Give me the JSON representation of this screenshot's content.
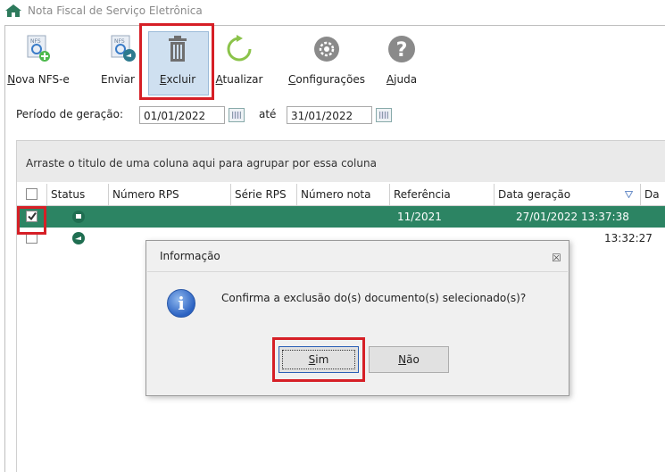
{
  "window": {
    "title": "Nota Fiscal de Serviço Eletrônica",
    "home_icon": "home-icon"
  },
  "toolbar": {
    "buttons": [
      {
        "label": "Nova NFS-e",
        "underline": "N",
        "rest": "ova NFS-e",
        "icon": "new-nfse-icon"
      },
      {
        "label": "Enviar",
        "underline": "",
        "rest": "Enviar",
        "icon": "send-nfse-icon"
      },
      {
        "label": "Excluir",
        "underline": "E",
        "rest": "xcluir",
        "icon": "trash-icon"
      },
      {
        "label": "Atualizar",
        "underline": "A",
        "rest": "tualizar",
        "icon": "refresh-icon"
      },
      {
        "label": "Configurações",
        "underline": "C",
        "rest": "onfigurações",
        "icon": "gear-icon"
      },
      {
        "label": "Ajuda",
        "underline": "A",
        "rest": "juda",
        "icon": "help-icon"
      }
    ]
  },
  "filters": {
    "period_label": "Período de geração:",
    "start_date": "01/01/2022",
    "until_label": "até",
    "end_date": "31/01/2022"
  },
  "grid": {
    "group_hint": "Arraste o titulo de uma coluna aqui para agrupar por essa coluna",
    "columns": [
      "Status",
      "Número RPS",
      "Série RPS",
      "Número nota",
      "Referência",
      "Data geração",
      "Da"
    ],
    "rows": [
      {
        "checked": true,
        "status_icon": "flag-icon",
        "referencia": "11/2021",
        "data_geracao": "27/01/2022 13:37:38",
        "selected": true
      },
      {
        "checked": false,
        "status_icon": "sent-arrow-icon",
        "referencia": "",
        "data_geracao": "13:32:27",
        "selected": false
      }
    ]
  },
  "dialog": {
    "title": "Informação",
    "close_glyph": "☒",
    "message": "Confirma a exclusão do(s) documento(s) selecionado(s)?",
    "yes_underline": "S",
    "yes_rest": "im",
    "no_underline": "N",
    "no_rest": "ão"
  },
  "colors": {
    "selected_row": "#2c8463",
    "highlight": "#d61f26",
    "toolbar_selected": "#cfe0f0"
  }
}
